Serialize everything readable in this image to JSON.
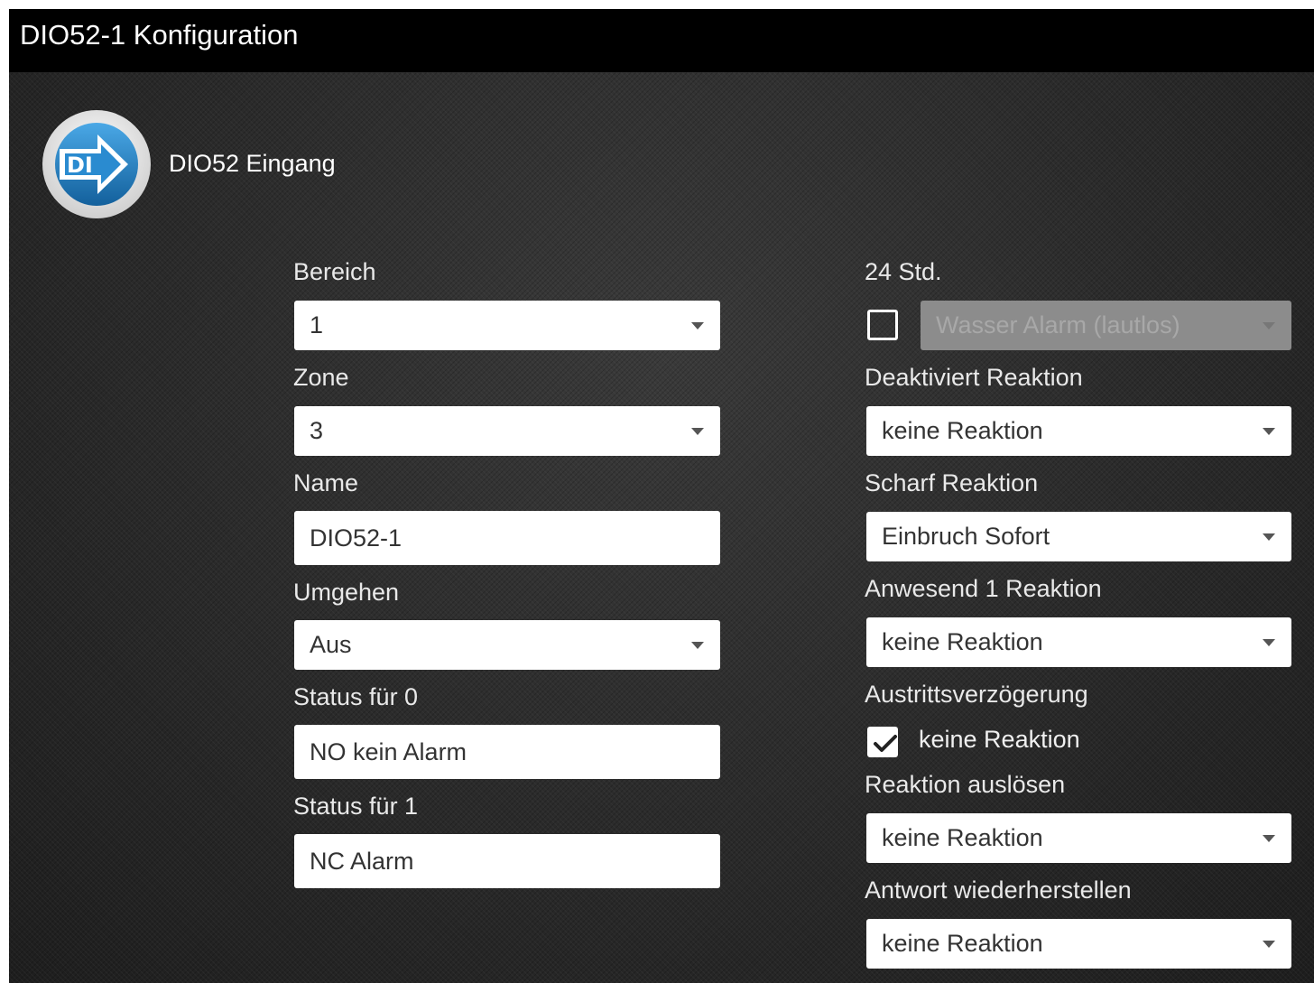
{
  "window": {
    "title": "DIO52-1 Konfiguration"
  },
  "device": {
    "icon_name": "di-input-icon",
    "icon_text": "DI",
    "label": "DIO52 Eingang"
  },
  "left": {
    "bereich": {
      "label": "Bereich",
      "value": "1"
    },
    "zone": {
      "label": "Zone",
      "value": "3"
    },
    "name": {
      "label": "Name",
      "value": "DIO52-1"
    },
    "umgehen": {
      "label": "Umgehen",
      "value": "Aus"
    },
    "status0": {
      "label": "Status für 0",
      "value": "NO kein Alarm"
    },
    "status1": {
      "label": "Status für 1",
      "value": "NC Alarm"
    }
  },
  "right": {
    "std24": {
      "label": "24 Std.",
      "checked": false,
      "value": "Wasser Alarm (lautlos)",
      "disabled": true
    },
    "deaktiviert": {
      "label": "Deaktiviert Reaktion",
      "value": "keine Reaktion"
    },
    "scharf": {
      "label": "Scharf Reaktion",
      "value": "Einbruch Sofort"
    },
    "anwesend1": {
      "label": "Anwesend 1 Reaktion",
      "value": "keine Reaktion"
    },
    "austritt": {
      "label": "Austrittsverzögerung",
      "checked": true,
      "value": "keine Reaktion"
    },
    "ausloesen": {
      "label": "Reaktion auslösen",
      "value": "keine Reaktion"
    },
    "wiederherstellen": {
      "label": "Antwort wiederherstellen",
      "value": "keine Reaktion"
    }
  },
  "colors": {
    "titlebar": "#000000",
    "panel": "#2a2a2a",
    "icon_blue": "#1f7fc4"
  }
}
